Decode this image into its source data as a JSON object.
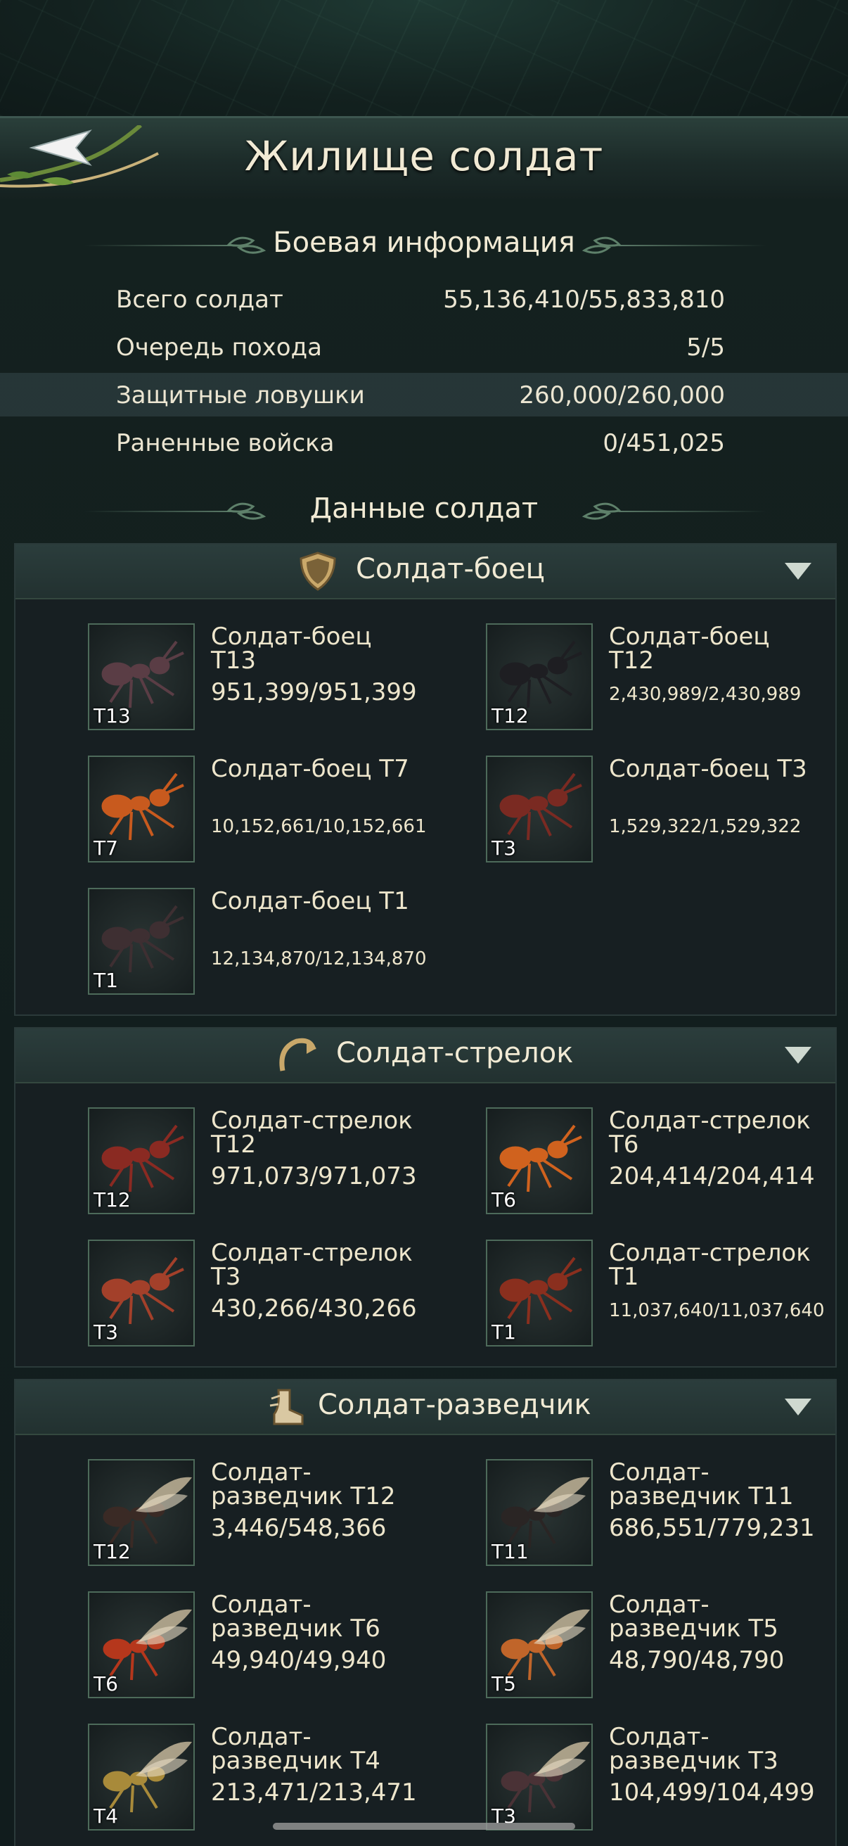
{
  "header": {
    "title": "Жилище солдат",
    "back_icon": "back-arrow-icon"
  },
  "battle_info": {
    "heading": "Боевая информация",
    "rows": [
      {
        "label": "Всего солдат",
        "value": "55,136,410/55,833,810"
      },
      {
        "label": "Очередь похода",
        "value": "5/5"
      },
      {
        "label": "Защитные ловушки",
        "value": "260,000/260,000"
      },
      {
        "label": "Раненные войска",
        "value": "0/451,025"
      }
    ]
  },
  "soldier_data": {
    "heading": "Данные солдат"
  },
  "categories": [
    {
      "title": "Солдат-боец",
      "icon": "shield-icon",
      "units": [
        {
          "name": "Солдат-боец T13",
          "count": "951,399/951,399",
          "tier": "T13",
          "color": "#5a3d45"
        },
        {
          "name": "Солдат-боец T12",
          "count": "2,430,989/2,430,989",
          "tier": "T12",
          "color": "#1e1e22"
        },
        {
          "name": "Солдат-боец T7",
          "count": "10,152,661/10,152,661",
          "tier": "T7",
          "color": "#c85a1e"
        },
        {
          "name": "Солдат-боец T3",
          "count": "1,529,322/1,529,322",
          "tier": "T3",
          "color": "#7a2a22"
        },
        {
          "name": "Солдат-боец T1",
          "count": "12,134,870/12,134,870",
          "tier": "T1",
          "color": "#3e2f32"
        }
      ]
    },
    {
      "title": "Солдат-стрелок",
      "icon": "bow-icon",
      "units": [
        {
          "name": "Солдат-стрелок T12",
          "count": "971,073/971,073",
          "tier": "T12",
          "color": "#8a2a22"
        },
        {
          "name": "Солдат-стрелок T6",
          "count": "204,414/204,414",
          "tier": "T6",
          "color": "#d0621e"
        },
        {
          "name": "Солдат-стрелок T3",
          "count": "430,266/430,266",
          "tier": "T3",
          "color": "#a3402a"
        },
        {
          "name": "Солдат-стрелок T1",
          "count": "11,037,640/11,037,640",
          "tier": "T1",
          "color": "#8a2f1e"
        }
      ]
    },
    {
      "title": "Солдат-разведчик",
      "icon": "boot-icon",
      "units": [
        {
          "name": "Солдат-разведчик T12",
          "count": "3,446/548,366",
          "tier": "T12",
          "color": "#3a2a25"
        },
        {
          "name": "Солдат-разведчик T11",
          "count": "686,551/779,231",
          "tier": "T11",
          "color": "#2a2524"
        },
        {
          "name": "Солдат-разведчик T6",
          "count": "49,940/49,940",
          "tier": "T6",
          "color": "#b5371c"
        },
        {
          "name": "Солдат-разведчик T5",
          "count": "48,790/48,790",
          "tier": "T5",
          "color": "#c0652a"
        },
        {
          "name": "Солдат-разведчик T4",
          "count": "213,471/213,471",
          "tier": "T4",
          "color": "#a88a3a"
        },
        {
          "name": "Солдат-разведчик T3",
          "count": "104,499/104,499",
          "tier": "T3",
          "color": "#4a3236"
        }
      ]
    }
  ]
}
